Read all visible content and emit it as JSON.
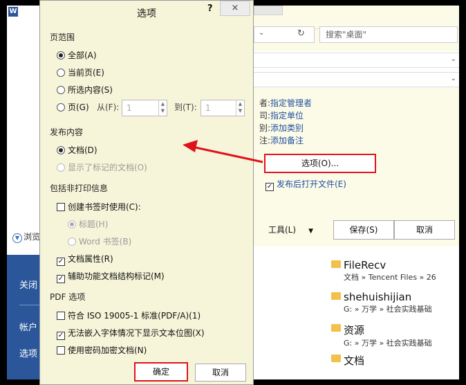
{
  "nav": {
    "logo": "W",
    "browse": "浏览",
    "items": [
      "关闭",
      "帐户",
      "选项"
    ]
  },
  "save_dialog": {
    "search_placeholder": "搜索\"桌面\"",
    "meta": [
      {
        "label": "者:",
        "value": "指定管理者"
      },
      {
        "label": "司:",
        "value": "指定单位"
      },
      {
        "label": "别:",
        "value": "添加类别"
      },
      {
        "label": "注:",
        "value": "添加备注"
      }
    ],
    "options_button": "选项(O)...",
    "open_after": "发布后打开文件(E)",
    "tools": "工具(L)",
    "save_button": "保存(S)",
    "cancel_button": "取消",
    "files": [
      {
        "name": "FileRecv",
        "path": "文档 » Tencent Files » 26"
      },
      {
        "name": "shehuishijian",
        "path": "G: » 万学 » 社会实践基础"
      },
      {
        "name": "资源",
        "path": "G: » 万学 » 社会实践基础"
      },
      {
        "name": "文档",
        "path": ""
      }
    ]
  },
  "options_dialog": {
    "title": "选项",
    "help": "?",
    "close": "×",
    "range": {
      "header": "页范围",
      "all": "全部(A)",
      "current": "当前页(E)",
      "selection": "所选内容(S)",
      "pages": "页(G)",
      "from_label": "从(F):",
      "from_value": "1",
      "to_label": "到(T):",
      "to_value": "1"
    },
    "publish": {
      "header": "发布内容",
      "document": "文档(D)",
      "markup": "显示了标记的文档(O)"
    },
    "nonprint": {
      "header": "包括非打印信息",
      "bookmarks": "创建书签时使用(C):",
      "headings": "标题(H)",
      "word_bookmarks": "Word 书签(B)",
      "doc_props": "文档属性(R)",
      "structure_tags": "辅助功能文档结构标记(M)"
    },
    "pdf": {
      "header": "PDF 选项",
      "iso": "符合 ISO 19005-1 标准(PDF/A)(1)",
      "bitmap": "无法嵌入字体情况下显示文本位图(X)",
      "encrypt": "使用密码加密文档(N)"
    },
    "ok": "确定",
    "cancel": "取消"
  },
  "colors": {
    "accent_red": "#e0121c",
    "dialog_bg": "#f6f5d9",
    "link_blue": "#1f4e9c",
    "word_blue": "#2b579a"
  }
}
